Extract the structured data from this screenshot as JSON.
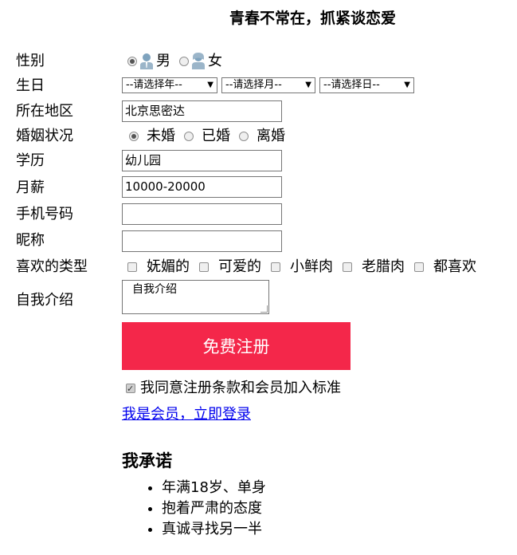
{
  "title": "青春不常在，抓紧谈恋爱",
  "labels": {
    "gender": "性别",
    "birthday": "生日",
    "region": "所在地区",
    "marital": "婚姻状况",
    "education": "学历",
    "salary": "月薪",
    "phone": "手机号码",
    "nickname": "昵称",
    "likes": "喜欢的类型",
    "intro": "自我介绍"
  },
  "gender": {
    "male": "男",
    "female": "女",
    "selected": "男"
  },
  "birthday": {
    "year": "--请选择年--",
    "month": "--请选择月--",
    "day": "--请选择日--"
  },
  "region_value": "北京思密达",
  "marital": {
    "options": [
      "未婚",
      "已婚",
      "离婚"
    ],
    "selected": "未婚"
  },
  "education_value": "幼儿园",
  "salary_value": "10000-20000",
  "phone_value": "",
  "nickname_value": "",
  "likes": [
    "妩媚的",
    "可爱的",
    "小鲜肉",
    "老腊肉",
    "都喜欢"
  ],
  "intro_value": "自我介绍",
  "register_label": "免费注册",
  "agree_label": "我同意注册条款和会员加入标准",
  "login_link": "我是会员，立即登录",
  "promise_title": "我承诺",
  "promises": [
    "年满18岁、单身",
    "抱着严肃的态度",
    "真诚寻找另一半"
  ],
  "colors": {
    "register_button": "#f4274a",
    "link": "#0000ee"
  }
}
